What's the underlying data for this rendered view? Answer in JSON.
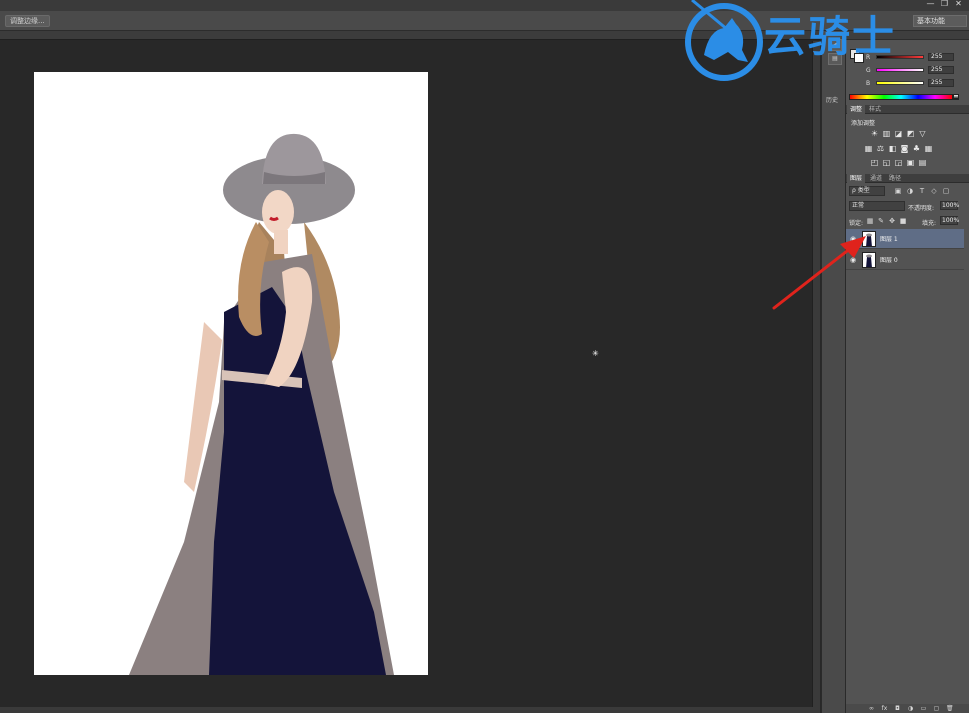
{
  "window": {
    "controls": [
      "—",
      "❐",
      "✕"
    ]
  },
  "options_bar": {
    "refine_button": "调整边缘..."
  },
  "workspace": {
    "selector": "基本功能"
  },
  "icon_strip": {
    "label": "历史"
  },
  "color_panel": {
    "channels": [
      {
        "label": "R",
        "value": "255"
      },
      {
        "label": "G",
        "value": "255"
      },
      {
        "label": "B",
        "value": "255"
      }
    ],
    "channel_colors": [
      "#ff3b3b",
      "#44e044",
      "#4a6dff"
    ]
  },
  "adjustments_panel": {
    "tabs": [
      "调整",
      "样式"
    ],
    "title": "添加调整"
  },
  "layers_panel": {
    "tabs": [
      "图层",
      "通道",
      "路径"
    ],
    "filter": "ρ 类型",
    "blend_mode": "正常",
    "opacity_label": "不透明度:",
    "opacity_value": "100%",
    "lock_label": "锁定:",
    "fill_label": "填充:",
    "fill_value": "100%",
    "layers": [
      {
        "name": "图层 1",
        "selected": true
      },
      {
        "name": "图层 0",
        "selected": false
      }
    ]
  },
  "watermark": {
    "text": "云骑士",
    "color": "#2b8de6"
  },
  "annotation": {
    "arrow_color": "#e0231c"
  }
}
